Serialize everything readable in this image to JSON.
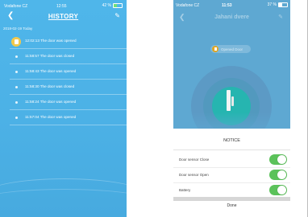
{
  "history_screen": {
    "status_bar": {
      "carrier": "Vodafone CZ",
      "time": "12:55",
      "battery": "42 %"
    },
    "title": "HISTORY",
    "back_icon": "chevron-left",
    "edit_icon": "pencil",
    "date_label": "2018-02-19 Today",
    "events": [
      {
        "time": "12:02:13",
        "text": "The door was opened",
        "highlight": true
      },
      {
        "time": "11:58:57",
        "text": "The door was closed",
        "highlight": false
      },
      {
        "time": "11:58:43",
        "text": "The door was opened",
        "highlight": false
      },
      {
        "time": "11:58:30",
        "text": "The door was closed",
        "highlight": false
      },
      {
        "time": "11:58:24",
        "text": "The door was opened",
        "highlight": false
      },
      {
        "time": "11:57:04",
        "text": "The door was opened",
        "highlight": false
      }
    ],
    "colors": {
      "background": "#4fb6ea",
      "badge": "#f2c94c"
    }
  },
  "device_screen": {
    "status_bar": {
      "carrier": "Vodafone CZ",
      "time": "11:53",
      "battery": "37 %"
    },
    "title": "Jahani dvere",
    "status_chip": "Opened Door",
    "notice_title": "NOTICE",
    "notice_items": [
      {
        "label": "Door sensor Close",
        "enabled": true
      },
      {
        "label": "Door sensor Open",
        "enabled": true
      },
      {
        "label": "Battery",
        "enabled": true
      }
    ],
    "done_label": "Done",
    "colors": {
      "header": "#5ea8d2",
      "sensor_circle": "#26b5b0",
      "toggle_on": "#5bc25a"
    }
  }
}
